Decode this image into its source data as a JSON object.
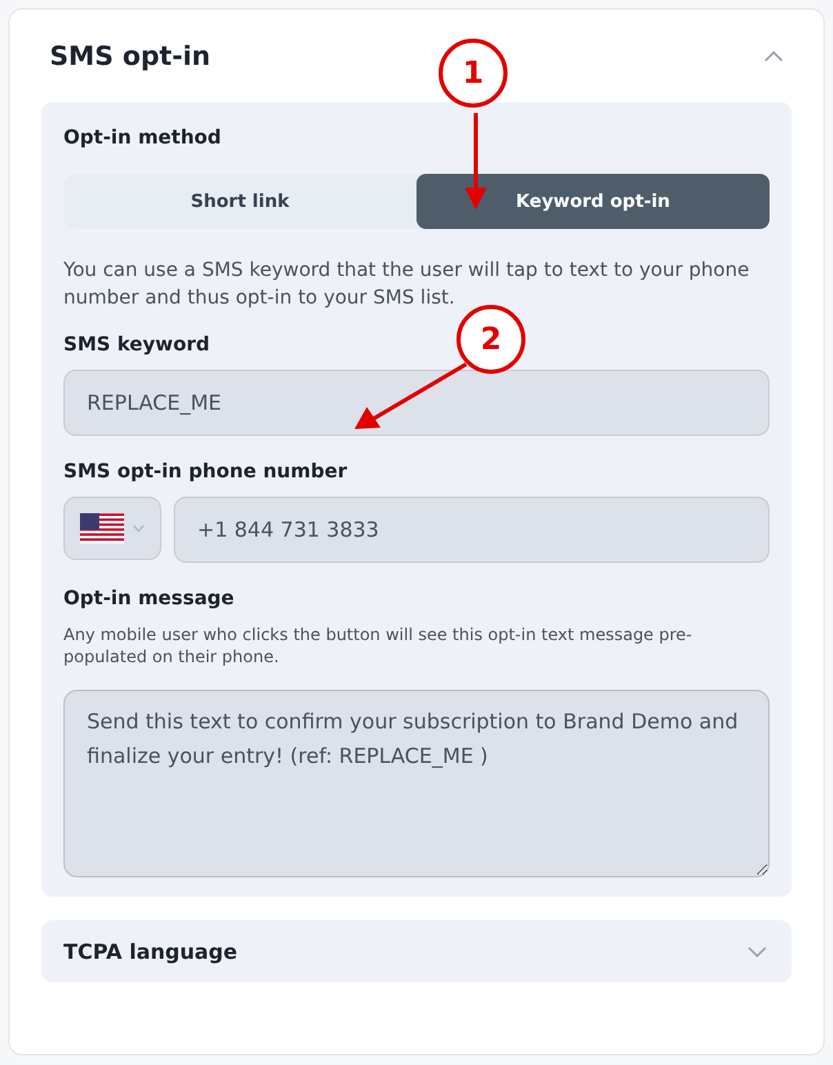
{
  "section": {
    "title": "SMS opt-in",
    "expanded": true
  },
  "method": {
    "label": "Opt-in method",
    "options": [
      {
        "label": "Short link",
        "selected": false
      },
      {
        "label": "Keyword opt-in",
        "selected": true
      }
    ]
  },
  "description": "You can use a SMS keyword that the user will tap to text to your phone number and thus opt-in to your SMS list.",
  "keyword": {
    "label": "SMS keyword",
    "value": "REPLACE_ME"
  },
  "phone": {
    "label": "SMS opt-in phone number",
    "value": "+1 844 731 3833"
  },
  "message": {
    "label": "Opt-in message",
    "help": "Any mobile user who clicks the button will see this opt-in text message pre-populated on their phone.",
    "value": "Send this text to confirm your subscription to Brand Demo and finalize your entry! (ref: REPLACE_ME )"
  },
  "tcpa": {
    "title": "TCPA language",
    "expanded": false
  },
  "annotations": [
    {
      "label": "1",
      "kind": "down"
    },
    {
      "label": "2",
      "kind": "diagonal"
    }
  ]
}
